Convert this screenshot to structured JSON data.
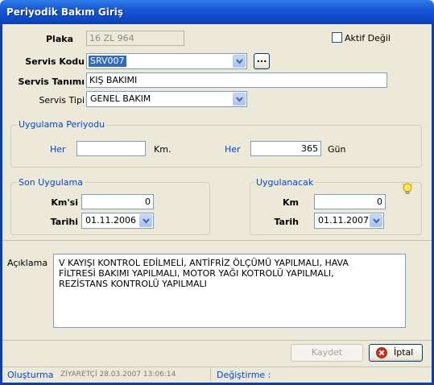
{
  "window": {
    "title": "Periyodik Bakım Giriş"
  },
  "form": {
    "plaka_label": "Plaka",
    "plaka_value": "16 ZL 964",
    "aktif_label": "Aktif Değil",
    "servis_kodu_label": "Servis Kodu",
    "servis_kodu_value": "SRV007",
    "browse_label": "...",
    "servis_tanimi_label": "Servis Tanımı",
    "servis_tanimi_value": "KIŞ BAKIMI",
    "servis_tipi_label": "Servis Tipi",
    "servis_tipi_value": "GENEL BAKIM"
  },
  "period": {
    "title": "Uygulama Periyodu",
    "her1_label": "Her",
    "km_value": "",
    "km_unit": "Km.",
    "her2_label": "Her",
    "gun_value": "365",
    "gun_unit": "Gün"
  },
  "last": {
    "title": "Son Uygulama",
    "km_label": "Km'si",
    "km_value": "0",
    "date_label": "Tarihi",
    "date_value": "01.11.2006"
  },
  "next": {
    "title": "Uygulanacak",
    "km_label": "Km",
    "km_value": "0",
    "date_label": "Tarih",
    "date_value": "01.11.2007",
    "tip_icon": "lightbulb-icon"
  },
  "notes": {
    "label": "Açıklama",
    "line1": "V KAYIŞI KONTROL EDİLMELİ, ANTİFRİZ ÖLÇÜMÜ YAPILMALI, HAVA",
    "line2": "FİLTRESİ BAKIMI YAPILMALI, MOTOR YAĞI KOTROLÜ YAPILMALI,",
    "line3": "REZİSTANS KONTROLÜ YAPILMALI"
  },
  "buttons": {
    "save_label": "Kaydet",
    "cancel_label": "İptal",
    "cancel_icon": "cancel-icon"
  },
  "status": {
    "created_label": "Oluşturma",
    "created_value": "ZİYARETÇİ 28.03.2007 13:06:14",
    "modified_label": "Değiştirme :"
  },
  "colors": {
    "title_bar": "#0f4ccc",
    "group_title": "#0046d5",
    "selection": "#316ac5",
    "cancel_red": "#d8281b"
  }
}
